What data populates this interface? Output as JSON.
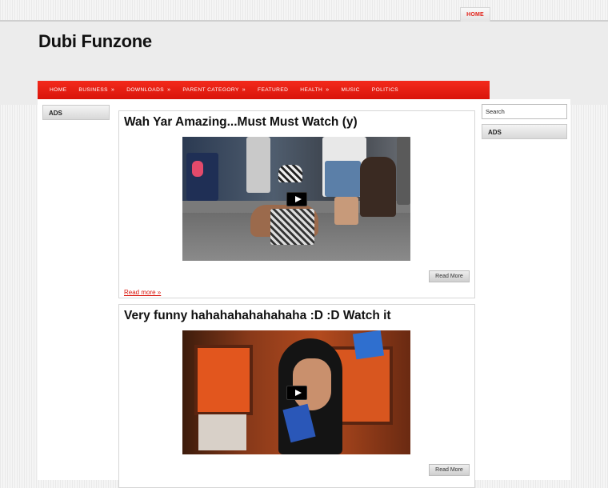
{
  "top_nav": {
    "home": "HOME"
  },
  "site": {
    "title": "Dubi Funzone"
  },
  "nav": [
    {
      "label": "HOME",
      "arrow": ""
    },
    {
      "label": "BUSINESS",
      "arrow": "»"
    },
    {
      "label": "DOWNLOADS",
      "arrow": "»"
    },
    {
      "label": "PARENT CATEGORY",
      "arrow": "»"
    },
    {
      "label": "FEATURED",
      "arrow": ""
    },
    {
      "label": "HEALTH",
      "arrow": "»"
    },
    {
      "label": "MUSIC",
      "arrow": ""
    },
    {
      "label": "POLITICS",
      "arrow": ""
    }
  ],
  "sidebar_left": {
    "ads_title": "ADS"
  },
  "sidebar_right": {
    "search_placeholder": "Search",
    "ads_title": "ADS"
  },
  "posts": [
    {
      "title": "Wah Yar Amazing...Must Must Watch (y)",
      "read_more_button": "Read More",
      "read_more_link": "Read more »"
    },
    {
      "title": "Very funny hahahahahahahaha :D :D Watch it",
      "read_more_button": "Read More"
    }
  ],
  "colors": {
    "nav_red": "#e2231a",
    "link_red": "#d9140a"
  },
  "icons": {
    "play": "play-icon"
  }
}
